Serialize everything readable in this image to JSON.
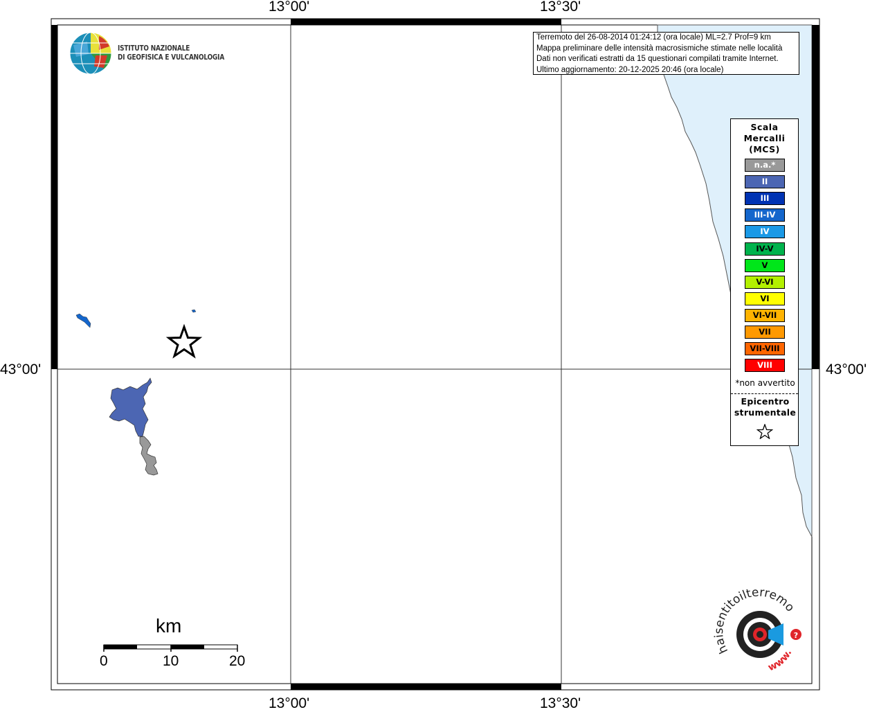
{
  "map": {
    "top_ticks": [
      "13°00'",
      "13°30'"
    ],
    "bottom_ticks": [
      "13°00'",
      "13°30'"
    ],
    "left_tick": "43°00'",
    "right_tick": "43°00'"
  },
  "logo": {
    "institute_line1": "ISTITUTO NAZIONALE",
    "institute_line2": "DI GEOFISICA E VULCANOLOGIA",
    "hsit_text": "haisentitoilterremoto.it",
    "hsit_www": "www."
  },
  "info": {
    "line1": "Terremoto del 26-08-2014 01:24:12 (ora locale) ML=2.7 Prof=9 km",
    "line2": "Mappa preliminare delle intensità macrosismiche stimate nelle località",
    "line3": "Dati non verificati estratti da 15 questionari compilati tramite Internet.",
    "line4": "Ultimo aggiornamento: 20-12-2025 20:46 (ora locale)"
  },
  "legend": {
    "title_line1": "Scala",
    "title_line2": "Mercalli",
    "title_line3": "(MCS)",
    "items": [
      {
        "label": "n.a.*",
        "color": "#999999",
        "text_color": "#ffffff"
      },
      {
        "label": "II",
        "color": "#4c66b3",
        "text_color": "#ffffff"
      },
      {
        "label": "III",
        "color": "#0033b3",
        "text_color": "#ffffff"
      },
      {
        "label": "III-IV",
        "color": "#1466cc",
        "text_color": "#ffffff"
      },
      {
        "label": "IV",
        "color": "#1a99e6",
        "text_color": "#ffffff"
      },
      {
        "label": "IV-V",
        "color": "#00b34d",
        "text_color": "#000000"
      },
      {
        "label": "V",
        "color": "#00e61a",
        "text_color": "#000000"
      },
      {
        "label": "V-VI",
        "color": "#b3f000",
        "text_color": "#000000"
      },
      {
        "label": "VI",
        "color": "#ffff00",
        "text_color": "#000000"
      },
      {
        "label": "VI-VII",
        "color": "#ffb300",
        "text_color": "#000000"
      },
      {
        "label": "VII",
        "color": "#ff9900",
        "text_color": "#000000"
      },
      {
        "label": "VII-VIII",
        "color": "#ff6600",
        "text_color": "#000000"
      },
      {
        "label": "VIII",
        "color": "#ff0000",
        "text_color": "#ffffff"
      }
    ],
    "note": "*non avvertito",
    "epicenter_line1": "Epicentro",
    "epicenter_line2": "strumentale"
  },
  "scalebar": {
    "unit": "km",
    "labels": [
      "0",
      "10",
      "20"
    ]
  },
  "colors": {
    "sea": "#dff0fb",
    "intensity_ii": "#4c66b3",
    "not_felt": "#999999",
    "intensity_iii_iv": "#1466cc"
  }
}
